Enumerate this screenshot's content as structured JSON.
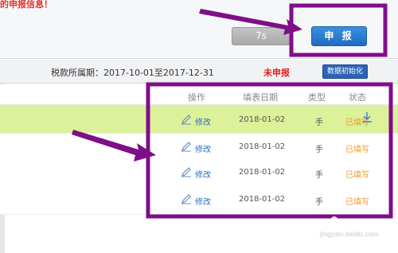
{
  "warning": {
    "text": "的申报信息！"
  },
  "actions": {
    "countdown_label": "7s",
    "declare_label": "申 报"
  },
  "period": {
    "text": "税款所属期：2017-10-01至2017-12-31",
    "status": "未申报",
    "init_button": "数据初始化"
  },
  "table": {
    "headers": [
      "操作",
      "填表日期",
      "类型",
      "状态"
    ],
    "rows": [
      {
        "action": "修改",
        "date": "2018-01-02",
        "type": "手",
        "status": "已填写"
      },
      {
        "action": "修改",
        "date": "2018-01-02",
        "type": "手",
        "status": "已填写"
      },
      {
        "action": "修改",
        "date": "2018-01-02",
        "type": "手",
        "status": "已填写"
      },
      {
        "action": "修改",
        "date": "2018-01-02",
        "type": "手",
        "status": "已填写"
      }
    ]
  },
  "watermark": {
    "text": "jingyan.baidu.com"
  },
  "colors": {
    "highlight_box": "#800d8a",
    "arrow": "#7d0f87",
    "declare_button": "#2a78d0",
    "init_button": "#2e63b4",
    "status_undeclared": "#e0201d",
    "status_filled": "#f39a1f",
    "row_highlight": "#ddf09a"
  },
  "icons": {
    "edit": "pencil-icon",
    "download": "download-icon"
  }
}
